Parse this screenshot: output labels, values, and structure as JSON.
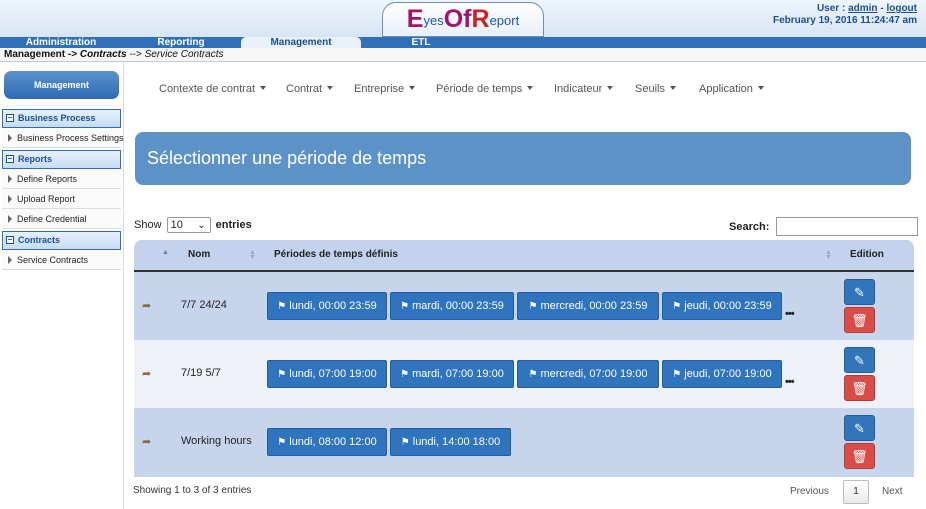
{
  "header": {
    "logo": {
      "e": "E",
      "yes": "yes",
      "of": "Of",
      "r": "R",
      "eport": "eport"
    },
    "user_label": "User :",
    "user_name": "admin",
    "separator": "-",
    "logout": "logout",
    "datetime": "February 19, 2016 11:24:47 am"
  },
  "nav": {
    "tabs": [
      {
        "label": "Administration",
        "active": false
      },
      {
        "label": "Reporting",
        "active": false
      },
      {
        "label": "Management",
        "active": true
      },
      {
        "label": "ETL",
        "active": false
      }
    ]
  },
  "breadcrumb": {
    "part1": "Management",
    "sep1": " -> ",
    "part2": "Contracts",
    "sep2": " --> ",
    "part3": "Service Contracts"
  },
  "sidebar": {
    "title": "Management",
    "sections": [
      {
        "label": "Business Process",
        "items": [
          "Business Process Settings"
        ]
      },
      {
        "label": "Reports",
        "items": [
          "Define Reports",
          "Upload Report",
          "Define Credential"
        ]
      },
      {
        "label": "Contracts",
        "items": [
          "Service Contracts"
        ]
      }
    ],
    "collapse_symbol": "−"
  },
  "menu": {
    "items": [
      "Contexte de contrat",
      "Contrat",
      "Entreprise",
      "Période de temps",
      "Indicateur",
      "Seuils",
      "Application"
    ]
  },
  "banner": {
    "title": "Sélectionner une période de temps"
  },
  "table_controls": {
    "show_label": "Show",
    "entries_value": "10",
    "entries_label": "entries",
    "search_label": "Search:",
    "search_value": ""
  },
  "table": {
    "headers": {
      "nom": "Nom",
      "periodes": "Périodes de temps définis",
      "edition": "Edition"
    },
    "rows": [
      {
        "nom": "7/7 24/24",
        "chips": [
          "lundi, 00:00 23:59",
          "mardi, 00:00 23:59",
          "mercredi, 00:00 23:59",
          "jeudi, 00:00 23:59"
        ],
        "more": "•••"
      },
      {
        "nom": "7/19 5/7",
        "chips": [
          "lundi, 07:00 19:00",
          "mardi, 07:00 19:00",
          "mercredi, 07:00 19:00",
          "jeudi, 07:00 19:00"
        ],
        "more": "•••"
      },
      {
        "nom": "Working hours",
        "chips": [
          "lundi, 08:00 12:00",
          "lundi, 14:00 18:00"
        ],
        "more": ""
      }
    ]
  },
  "footer": {
    "info": "Showing 1 to 3 of 3 entries",
    "previous": "Previous",
    "page": "1",
    "next": "Next"
  },
  "icons": {
    "tag": "tag-icon",
    "row_arrow": "share-arrow-icon",
    "edit": "pencil-icon",
    "delete": "trash-icon"
  },
  "colors": {
    "nav": "#2f70b8",
    "banner": "#5d92c7",
    "chip": "#2f74bd",
    "delete": "#d94c48"
  }
}
